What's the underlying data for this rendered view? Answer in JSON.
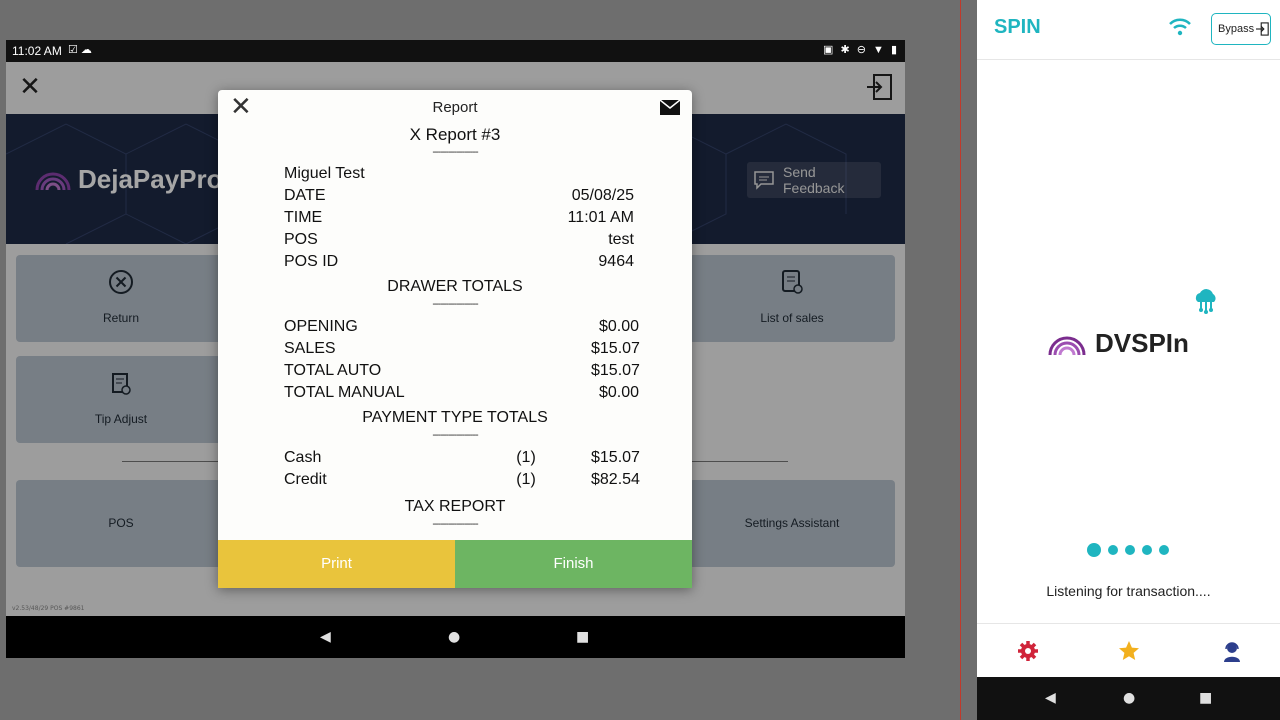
{
  "tablet": {
    "status": {
      "time": "11:02 AM"
    },
    "app": {
      "brand": "DejaPayPro",
      "feedback_label": "Send Feedback",
      "tiles": {
        "return": "Return",
        "tip_adjust": "Tip Adjust",
        "list_of_sales": "List of sales",
        "pos": "POS",
        "settings_assistant": "Settings Assistant"
      },
      "version": "v2.53/48/29 POS #9861"
    }
  },
  "report": {
    "title": "Report",
    "heading": "X Report  #3",
    "dashes": "-----------------",
    "name": "Miguel  Test",
    "rows": [
      {
        "label": "DATE",
        "value": "05/08/25"
      },
      {
        "label": "TIME",
        "value": "11:01  AM"
      },
      {
        "label": "POS",
        "value": "test"
      },
      {
        "label": "POS  ID",
        "value": "9464"
      }
    ],
    "drawer_heading": "DRAWER  TOTALS",
    "drawer_rows": [
      {
        "label": "OPENING",
        "value": "$0.00"
      },
      {
        "label": "SALES",
        "value": "$15.07"
      },
      {
        "label": "TOTAL  AUTO",
        "value": "$15.07"
      },
      {
        "label": "TOTAL  MANUAL",
        "value": "$0.00"
      }
    ],
    "payment_heading": "PAYMENT  TYPE  TOTALS",
    "payment_rows": [
      {
        "label": "Cash",
        "count": "(1)",
        "value": "$15.07"
      },
      {
        "label": "Credit",
        "count": "(1)",
        "value": "$82.54"
      }
    ],
    "tax_heading": "TAX  REPORT",
    "print_label": "Print",
    "finish_label": "Finish"
  },
  "phone": {
    "title": "SPIN",
    "bypass_label": "Bypass",
    "logo_text": "DVSPIn",
    "status_text": "Listening for transaction...."
  },
  "colors": {
    "accent": "#1fb5c0",
    "print": "#e9c43c",
    "finish": "#6db562",
    "gear": "#d0243a",
    "star": "#f2b01e",
    "support": "#2c3e8c"
  }
}
